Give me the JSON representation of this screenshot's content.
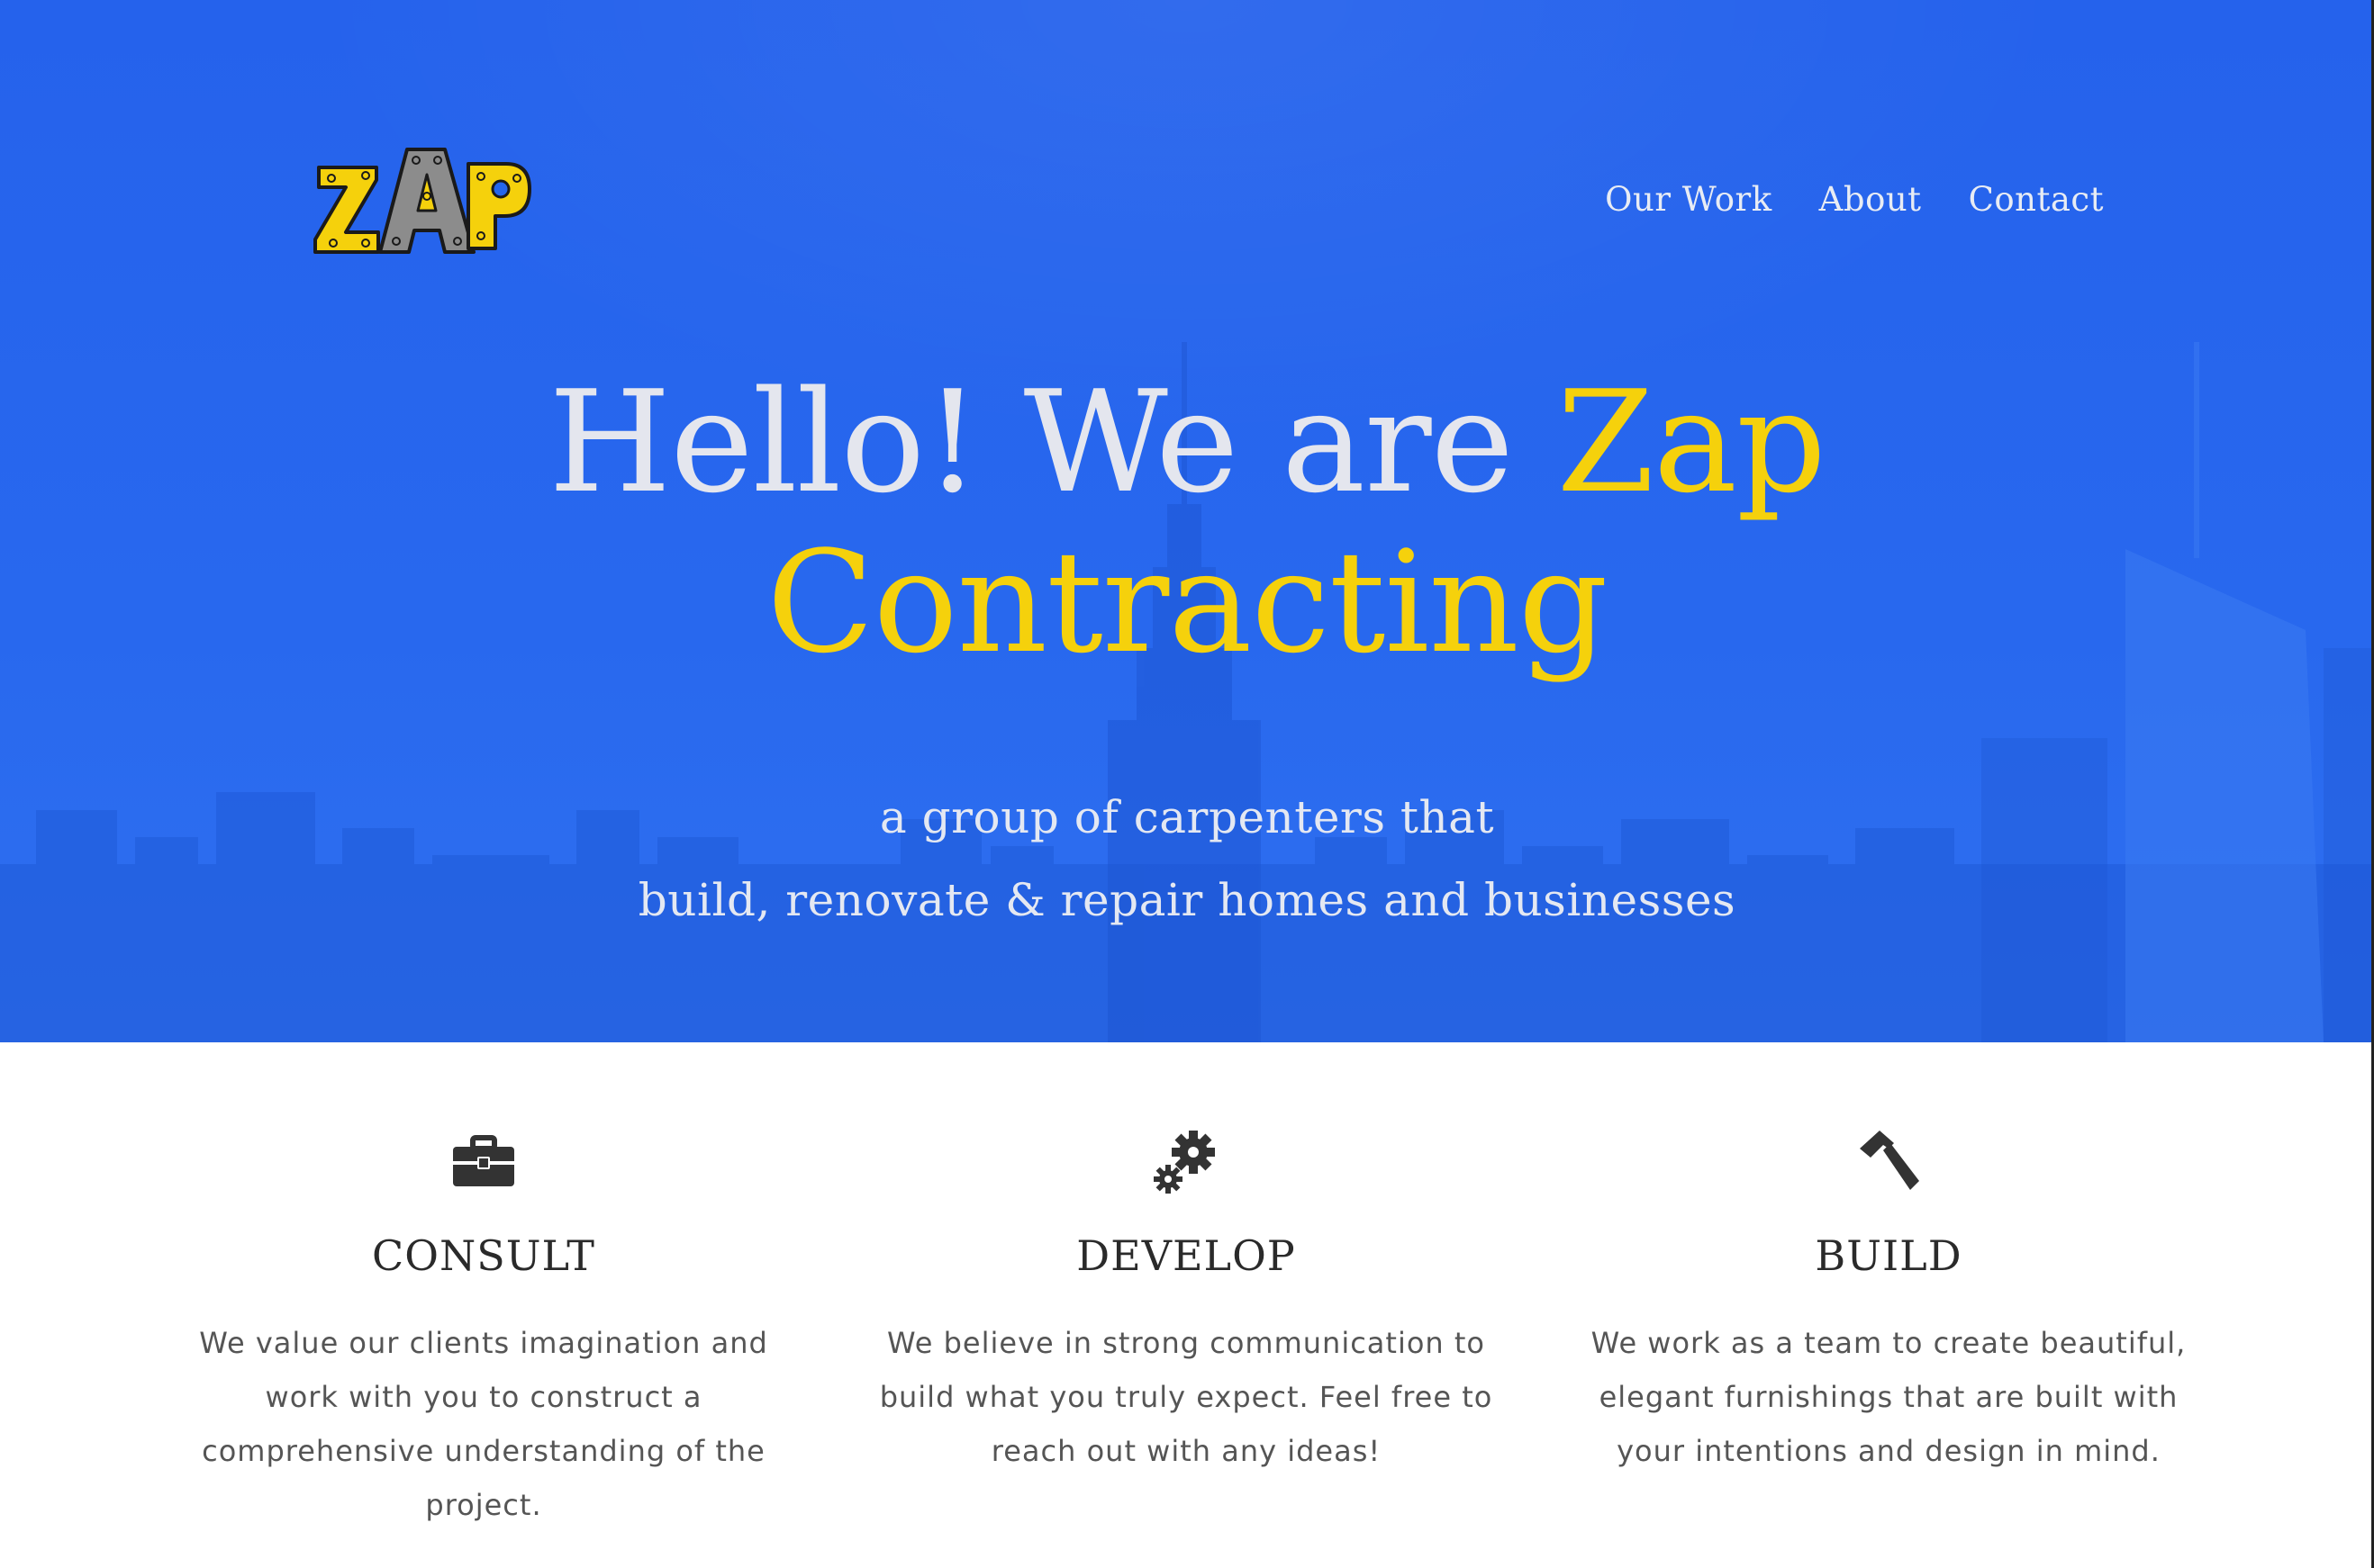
{
  "brand": {
    "logo_text": "ZAP",
    "colors": {
      "yellow": "#f5d10c",
      "gray": "#8c8c8c",
      "outline": "#1a1a1a"
    }
  },
  "nav": {
    "items": [
      {
        "label": "Our Work"
      },
      {
        "label": "About"
      },
      {
        "label": "Contact"
      }
    ]
  },
  "hero": {
    "headline_prefix": "Hello! We are",
    "headline_accent_1": "Zap",
    "headline_accent_2": "Contracting",
    "tagline_line_1": "a group of carpenters that",
    "tagline_line_2": "build, renovate & repair homes and businesses",
    "background_color": "#2566ec",
    "accent_color": "#f5d10c"
  },
  "features": [
    {
      "icon": "briefcase-icon",
      "title": "CONSULT",
      "text_lines": [
        "We value our clients imagination and",
        "work with you to construct a",
        "comprehensive understanding of the",
        "project."
      ]
    },
    {
      "icon": "gears-icon",
      "title": "DEVELOP",
      "text_lines": [
        "We believe in strong communication to",
        "build what you truly expect. Feel free to",
        "reach out with any ideas!"
      ]
    },
    {
      "icon": "hammer-icon",
      "title": "BUILD",
      "text_lines": [
        "We work as a team to create beautiful,",
        "elegant furnishings that are built with",
        "your intentions and design in mind."
      ]
    }
  ]
}
